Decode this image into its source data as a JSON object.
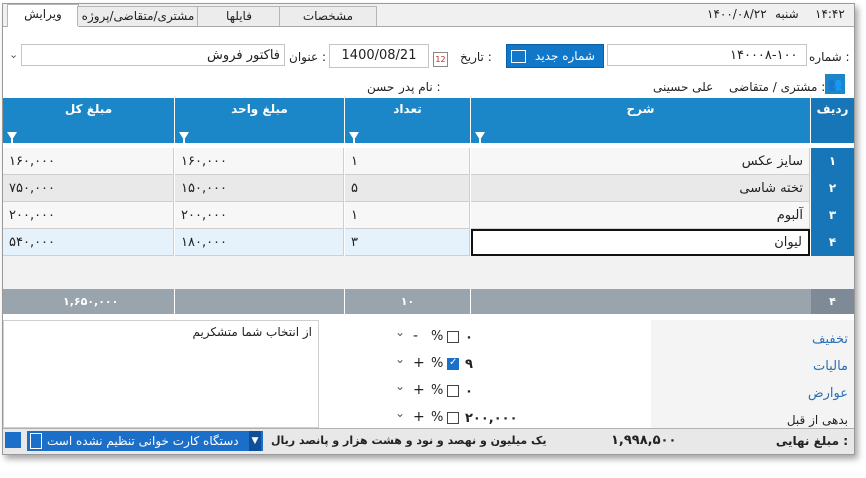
{
  "tabs": [
    {
      "label": "ویرایش",
      "active": true
    },
    {
      "label": "مشتری/متقاضی/پروژه",
      "active": false
    },
    {
      "label": "فایلها",
      "active": false
    },
    {
      "label": "مشخصات",
      "active": false
    }
  ],
  "clock": {
    "day": "شنبه",
    "date": "۱۴۰۰/۰۸/۲۲",
    "time": "۱۴:۴۲"
  },
  "header": {
    "number_label": "شماره :",
    "number_value": "۱۴۰۰۰۸-۱۰۰",
    "new_number_button": "شماره جدید",
    "date_label": "تاریخ :",
    "date_value": "1400/08/21",
    "calendar_icon_text": "12",
    "title_label": "عنوان :",
    "title_value": "فاکتور فروش"
  },
  "customer": {
    "label": "مشتری / متقاضی :",
    "name": "علی حسینی",
    "father_label": "نام پدر :",
    "father_name": "حسن"
  },
  "grid": {
    "columns": [
      "ردیف",
      "شرح",
      "تعداد",
      "مبلغ واحد",
      "مبلغ کل"
    ],
    "rows": [
      {
        "idx": "۱",
        "desc": "سایز عکس",
        "qty": "۱",
        "unit": "۱۶۰,۰۰۰",
        "total": "۱۶۰,۰۰۰"
      },
      {
        "idx": "۲",
        "desc": "تخته شاسی",
        "qty": "۵",
        "unit": "۱۵۰,۰۰۰",
        "total": "۷۵۰,۰۰۰"
      },
      {
        "idx": "۳",
        "desc": "آلبوم",
        "qty": "۱",
        "unit": "۲۰۰,۰۰۰",
        "total": "۲۰۰,۰۰۰"
      },
      {
        "idx": "۴",
        "desc": "لیوان",
        "qty": "۳",
        "unit": "۱۸۰,۰۰۰",
        "total": "۵۴۰,۰۰۰"
      }
    ],
    "totals": {
      "count": "۴",
      "qty": "۱۰",
      "total": "۱,۶۵۰,۰۰۰"
    }
  },
  "adjustments": [
    {
      "label": "تخفیف",
      "value": "۰",
      "checked": false,
      "sign": "-",
      "pct": "%"
    },
    {
      "label": "مالیات",
      "value": "۹",
      "checked": true,
      "sign": "+",
      "pct": "%"
    },
    {
      "label": "عوارض",
      "value": "۰",
      "checked": false,
      "sign": "+",
      "pct": "%"
    },
    {
      "label": "بدهی از قبل",
      "value": "۲۰۰,۰۰۰",
      "checked": false,
      "sign": "+",
      "pct": "%"
    }
  ],
  "note": "از انتخاب شما متشکریم",
  "footer": {
    "final_label": "مبلغ نهایی :",
    "final_value": "۱,۹۹۸,۵۰۰",
    "final_words": "یک میلیون و نهصد و نود و هشت هزار و پانصد ریال",
    "card_reader": "دستگاه کارت خوانی تنظیم نشده است"
  },
  "colors": {
    "accent": "#1b87c8",
    "row_header": "#1676b8",
    "total_row": "#9aa4ad"
  }
}
